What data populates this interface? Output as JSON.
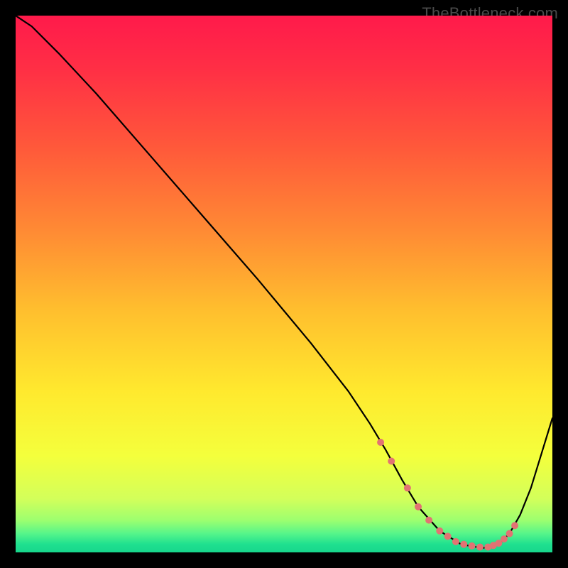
{
  "attribution": "TheBottleneck.com",
  "colors": {
    "background": "#000000",
    "attribution_text": "#4a4a4a",
    "curve": "#000000",
    "marker_fill": "#e27373",
    "gradient_stops": [
      {
        "offset": 0.0,
        "color": "#ff1a4b"
      },
      {
        "offset": 0.1,
        "color": "#ff2f45"
      },
      {
        "offset": 0.25,
        "color": "#ff5a3a"
      },
      {
        "offset": 0.4,
        "color": "#ff8a34"
      },
      {
        "offset": 0.55,
        "color": "#ffbf2e"
      },
      {
        "offset": 0.7,
        "color": "#ffe92e"
      },
      {
        "offset": 0.82,
        "color": "#f4ff3c"
      },
      {
        "offset": 0.9,
        "color": "#d3ff5a"
      },
      {
        "offset": 0.94,
        "color": "#9dff6f"
      },
      {
        "offset": 0.965,
        "color": "#56f58a"
      },
      {
        "offset": 0.985,
        "color": "#1fe08f"
      },
      {
        "offset": 1.0,
        "color": "#17d68c"
      }
    ]
  },
  "chart_data": {
    "type": "line",
    "title": "",
    "xlabel": "",
    "ylabel": "",
    "xlim": [
      0,
      100
    ],
    "ylim": [
      0,
      100
    ],
    "grid": false,
    "legend": false,
    "series": [
      {
        "name": "bottleneck-curve",
        "x": [
          0,
          3,
          8,
          15,
          25,
          35,
          45,
          55,
          62,
          66,
          69,
          72,
          75,
          79,
          83,
          87,
          90,
          92,
          94,
          96,
          98,
          100
        ],
        "y": [
          100,
          98,
          93,
          85.5,
          74,
          62.5,
          51,
          39,
          30,
          24,
          19,
          13.5,
          8.5,
          4,
          1.5,
          0.8,
          1.5,
          3.5,
          7,
          12,
          18.5,
          25
        ]
      }
    ],
    "markers": {
      "name": "highlight-points",
      "x": [
        68,
        70,
        73,
        75,
        77,
        79,
        80.5,
        82,
        83.5,
        85,
        86.5,
        88,
        89,
        90,
        91,
        92,
        93
      ],
      "y": [
        20.5,
        17,
        12,
        8.5,
        6,
        4,
        3,
        2,
        1.5,
        1.2,
        1,
        1,
        1.3,
        1.7,
        2.5,
        3.5,
        5
      ]
    }
  }
}
